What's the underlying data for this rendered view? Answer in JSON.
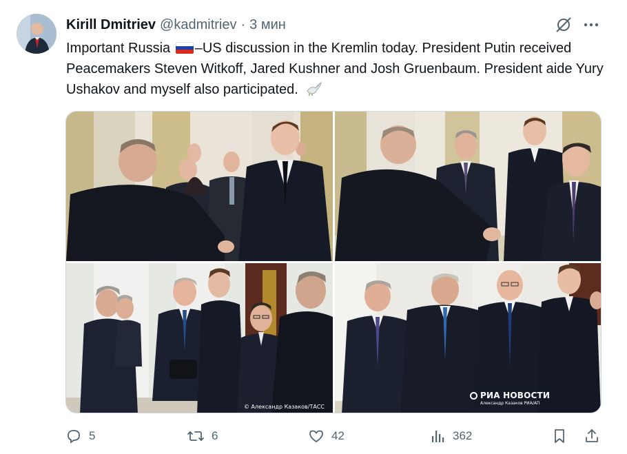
{
  "tweet": {
    "author_name": "Kirill Dmitriev",
    "author_handle": "@kadmitriev",
    "separator": "·",
    "time": "3 мин",
    "text_part1": "Important Russia",
    "text_part2": "–US discussion in the Kremlin today. President Putin received Peacemakers Steven Witkoff, Jared Kushner and Josh Gruenbaum. President aide Yury Ushakov and myself also participated.",
    "flag_emoji": "russia-flag",
    "dove_emoji": "dove"
  },
  "media": {
    "photo_credit": "© Александр Казаков/ТАСС",
    "watermark_title": "РИА НОВОСТИ",
    "watermark_sub": "Александр Казаков РИА/АП"
  },
  "actions": {
    "replies": "5",
    "retweets": "6",
    "likes": "42",
    "views": "362"
  },
  "icons": [
    "grok-icon",
    "more-icon",
    "reply-icon",
    "retweet-icon",
    "like-icon",
    "views-icon",
    "bookmark-icon",
    "share-icon"
  ],
  "colors": {
    "text": "#0f1419",
    "secondary": "#536471",
    "border": "#cfd9de"
  }
}
